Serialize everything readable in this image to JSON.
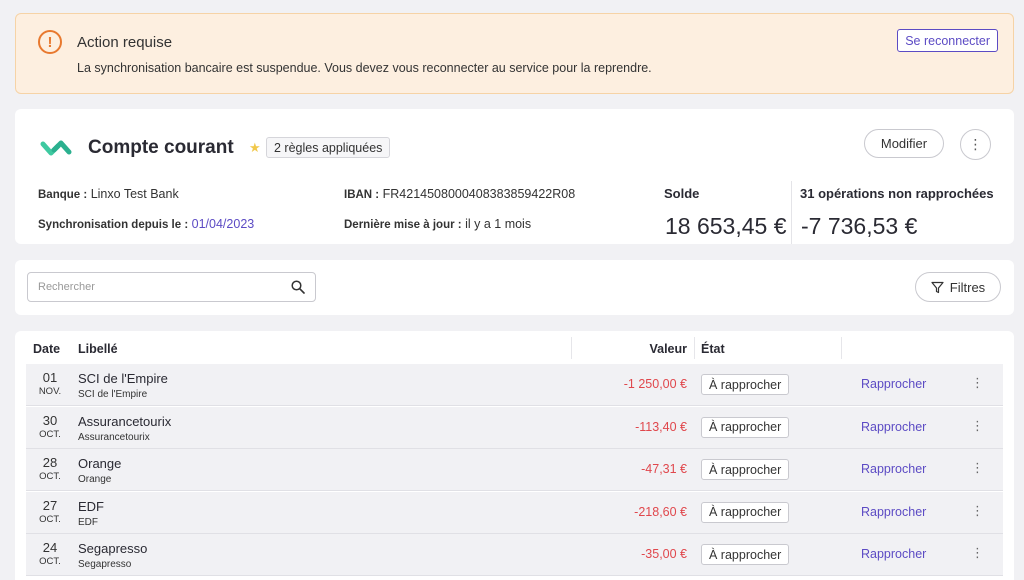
{
  "alert": {
    "title": "Action requise",
    "message": "La synchronisation bancaire est suspendue. Vous devez vous reconnecter au service pour la reprendre.",
    "button_label": "Se reconnecter",
    "icon": "exclamation-icon"
  },
  "account": {
    "title": "Compte courant",
    "rules_badge": "2 règles appliquées",
    "modify_label": "Modifier",
    "more_icon": "⋮",
    "bank_label": "Banque :",
    "bank_value": "Linxo Test Bank",
    "sync_label": "Synchronisation depuis le :",
    "sync_value": "01/04/2023",
    "iban_label": "IBAN :",
    "iban_value": "FR4214508000408383859422R08",
    "update_label": "Dernière mise à jour :",
    "update_value": "il y a 1 mois",
    "balance_label": "Solde",
    "balance_value": "18 653,45 €",
    "unreconciled_label": "31 opérations non rapprochées",
    "unreconciled_value": "-7 736,53 €"
  },
  "search": {
    "placeholder": "Rechercher",
    "filter_label": "Filtres"
  },
  "table": {
    "headers": {
      "date": "Date",
      "label": "Libellé",
      "value": "Valeur",
      "state": "État"
    },
    "rows": [
      {
        "day": "01",
        "month": "NOV.",
        "label": "SCI de l'Empire",
        "sublabel": "SCI de l'Empire",
        "amount": "-1 250,00 €",
        "state": "À rapprocher",
        "action": "Rapprocher"
      },
      {
        "day": "30",
        "month": "OCT.",
        "label": "Assurancetourix",
        "sublabel": "Assurancetourix",
        "amount": "-113,40 €",
        "state": "À rapprocher",
        "action": "Rapprocher"
      },
      {
        "day": "28",
        "month": "OCT.",
        "label": "Orange",
        "sublabel": "Orange",
        "amount": "-47,31 €",
        "state": "À rapprocher",
        "action": "Rapprocher"
      },
      {
        "day": "27",
        "month": "OCT.",
        "label": "EDF",
        "sublabel": "EDF",
        "amount": "-218,60 €",
        "state": "À rapprocher",
        "action": "Rapprocher"
      },
      {
        "day": "24",
        "month": "OCT.",
        "label": "Segapresso",
        "sublabel": "Segapresso",
        "amount": "-35,00 €",
        "state": "À rapprocher",
        "action": "Rapprocher"
      }
    ]
  },
  "colors": {
    "accent": "#5c4bc4",
    "warning": "#e8792f",
    "negative": "#e0474c",
    "alert_bg": "#fdefe0"
  }
}
